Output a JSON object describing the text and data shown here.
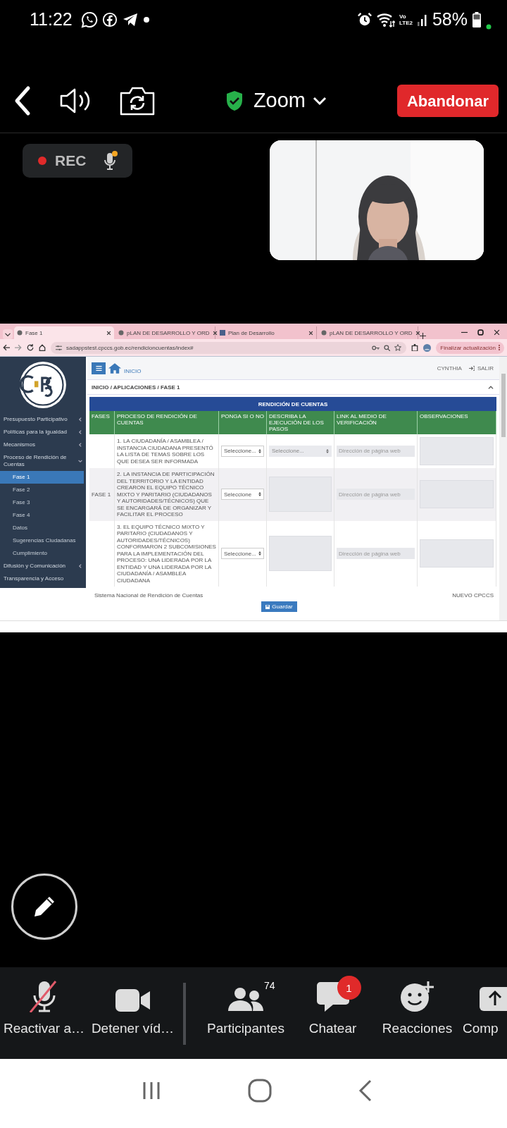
{
  "status_bar": {
    "time": "11:22",
    "network_top": "Vo",
    "network_bottom": "LTE2",
    "battery": "58%"
  },
  "meeting_bar": {
    "title": "Zoom",
    "leave_button": "Abandonar"
  },
  "recording": {
    "label": "REC"
  },
  "shared_screen": {
    "browser": {
      "tabs": [
        {
          "title": "Fase 1",
          "selected": true
        },
        {
          "title": "pLAN DE DESARROLLO Y ORD",
          "selected": false
        },
        {
          "title": "Plan de Desarrollo",
          "selected": false
        },
        {
          "title": "pLAN DE DESARROLLO Y ORD",
          "selected": false
        }
      ],
      "url": "sadappstest.cpccs.gob.ec/rendicioncuentas/index#",
      "update_button": "Finalizar actualización"
    },
    "sidebar": {
      "items": [
        {
          "label": "Presupuesto Participativo",
          "expanded": false
        },
        {
          "label": "Políticas para la Igualdad",
          "expanded": false
        },
        {
          "label": "Mecanismos",
          "expanded": false
        },
        {
          "label": "Proceso de Rendición de Cuentas",
          "expanded": true,
          "children": [
            {
              "label": "Fase 1",
              "selected": true
            },
            {
              "label": "Fase 2",
              "selected": false
            },
            {
              "label": "Fase 3",
              "selected": false
            },
            {
              "label": "Fase 4",
              "selected": false
            },
            {
              "label": "Datos",
              "selected": false
            },
            {
              "label": "Sugerencias Ciudadanas",
              "selected": false
            },
            {
              "label": "Cumplimiento",
              "selected": false
            }
          ]
        },
        {
          "label": "Difusión y Comunicación",
          "expanded": false
        },
        {
          "label": "Transparencia y Acceso"
        }
      ]
    },
    "header": {
      "home": "INICIO",
      "user": "CYNTHIA",
      "logout": "SALIR"
    },
    "breadcrumb": "INICIO / APLICACIONES / FASE 1",
    "panel_title": "RENDICIÓN DE CUENTAS",
    "table": {
      "columns": [
        "FASES",
        "PROCESO DE RENDICIÓN DE CUENTAS",
        "PONGA SI O NO",
        "DESCRIBA LA EJECUCIÓN DE LOS PASOS",
        "LINK AL MEDIO DE VERIFICACIÓN",
        "OBSERVACIONES"
      ],
      "rows": [
        {
          "process": "1. LA CIUDADANÍA / ASAMBLEA / INSTANCIA CIUDADANA PRESENTÓ LA LISTA DE TEMAS SOBRE LOS QUE DESEA SER INFORMADA",
          "answer": "Seleccione...",
          "description": {
            "kind": "select",
            "value": "Seleccione..."
          },
          "link_placeholder": "Dirección de página web"
        },
        {
          "phase": "FASE 1",
          "process": "2. LA INSTANCIA DE PARTICIPACIÓN DEL TERRITORIO Y LA ENTIDAD CREARON EL EQUIPO TÉCNICO MIXTO Y PARITARIO (CIUDADANOS Y AUTORIDADES/TÉCNICOS) QUE SE ENCARGARÁ DE ORGANIZAR Y FACILITAR EL PROCESO",
          "answer": "Seleccione",
          "description": {
            "kind": "textarea"
          },
          "link_placeholder": "Dirección de página web"
        },
        {
          "process": "3. EL EQUIPO TÉCNICO MIXTO Y PARITARIO (CIUDADANOS Y AUTORIDADES/TÉCNICOS) CONFORMARON 2 SUBCOMISIONES PARA LA IMPLEMENTACIÓN DEL PROCESO: UNA LIDERADA POR LA ENTIDAD Y UNA LIDERADA POR LA CIUDADANÍA / ASAMBLEA CIUDADANA",
          "answer": "Seleccione...",
          "description": {
            "kind": "textarea"
          },
          "link_placeholder": "Dirección de página web"
        }
      ]
    },
    "footer_left": "Sistema Nacional de Rendición de Cuentas",
    "footer_right": "NUEVO CPCCS",
    "save_button": "Guardar"
  },
  "toolbar": {
    "items": [
      {
        "kind": "mic-muted",
        "label": "Reactivar a…"
      },
      {
        "kind": "video",
        "label": "Detener víd…"
      },
      {
        "kind": "participants",
        "label": "Participantes",
        "count": "74"
      },
      {
        "kind": "chat",
        "label": "Chatear",
        "badge": "1"
      },
      {
        "kind": "reactions",
        "label": "Reacciones"
      },
      {
        "kind": "share",
        "label": "Comp"
      }
    ]
  }
}
